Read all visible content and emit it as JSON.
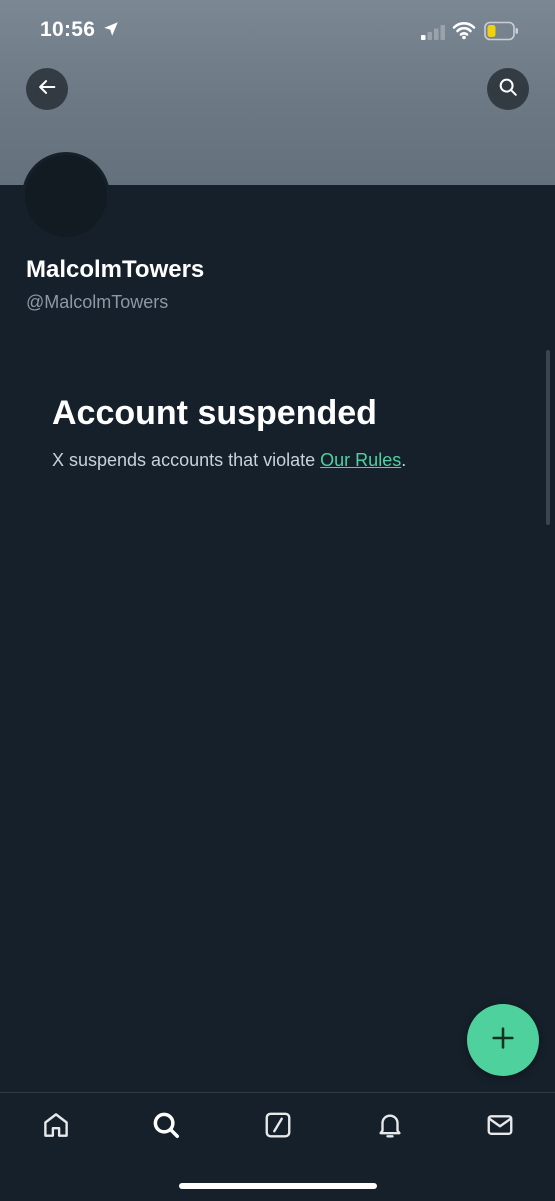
{
  "status_bar": {
    "time": "10:56",
    "icons": [
      "location-arrow-icon",
      "signal-icon",
      "wifi-icon",
      "battery-icon"
    ],
    "battery_color": "#f2d00a"
  },
  "header": {
    "back_icon": "back-arrow-icon",
    "search_icon": "search-icon"
  },
  "profile": {
    "display_name": "MalcolmTowers",
    "handle": "@MalcolmTowers"
  },
  "suspension": {
    "title": "Account suspended",
    "message_prefix": "X suspends accounts that violate ",
    "link_text": "Our Rules",
    "message_suffix": "."
  },
  "fab": {
    "icon": "plus-icon",
    "color": "#4fd19d"
  },
  "tab_bar": {
    "items": [
      {
        "icon": "home-icon"
      },
      {
        "icon": "search-icon"
      },
      {
        "icon": "compose-icon"
      },
      {
        "icon": "bell-icon"
      },
      {
        "icon": "mail-icon"
      }
    ]
  },
  "colors": {
    "background": "#16202a",
    "link": "#4fd1a0",
    "secondary_text": "#8b98a5"
  }
}
